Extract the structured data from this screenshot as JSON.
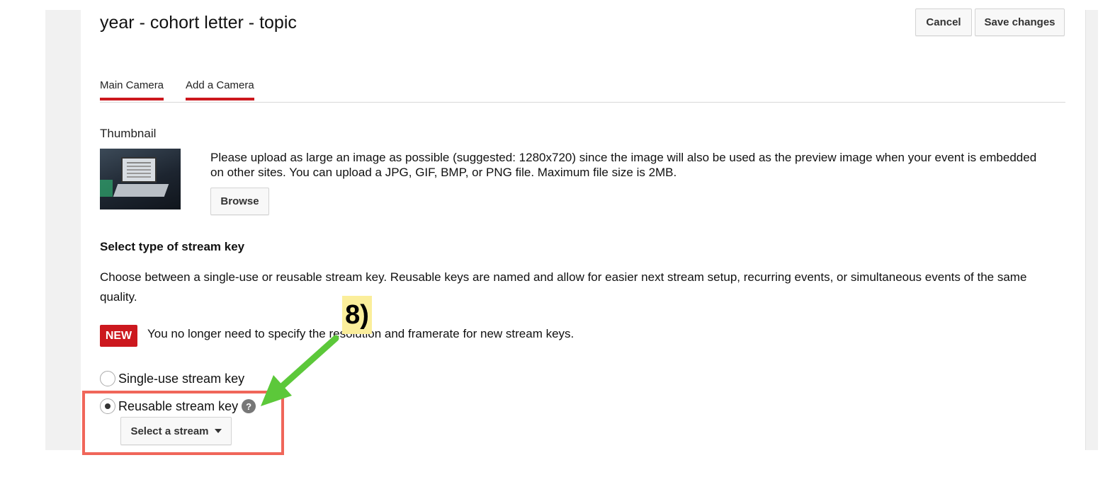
{
  "page": {
    "title": "year - cohort letter - topic"
  },
  "header": {
    "cancel_label": "Cancel",
    "save_label": "Save changes"
  },
  "tabs": [
    {
      "label": "Main Camera"
    },
    {
      "label": "Add a Camera"
    }
  ],
  "thumbnail": {
    "label": "Thumbnail",
    "description": "Please upload as large an image as possible (suggested: 1280x720) since the image will also be used as the preview image when your event is embedded on other sites. You can upload a JPG, GIF, BMP, or PNG file. Maximum file size is 2MB.",
    "browse_label": "Browse"
  },
  "stream_key": {
    "heading": "Select type of stream key",
    "description": "Choose between a single-use or reusable stream key. Reusable keys are named and allow for easier next stream setup, recurring events, or simultaneous events of the same quality.",
    "new_badge": "NEW",
    "new_notice": "You no longer need to specify the resolution and framerate for new stream keys.",
    "options": [
      {
        "label": "Single-use stream key",
        "selected": false
      },
      {
        "label": "Reusable stream key",
        "selected": true
      }
    ],
    "help_icon_glyph": "?",
    "select_stream_label": "Select a stream"
  },
  "annotation": {
    "step_label": "8)",
    "highlight_color": "#f0665a",
    "arrow_color": "#5cc83a",
    "label_bg": "#fbee9b"
  },
  "colors": {
    "accent_red": "#cc181e"
  }
}
